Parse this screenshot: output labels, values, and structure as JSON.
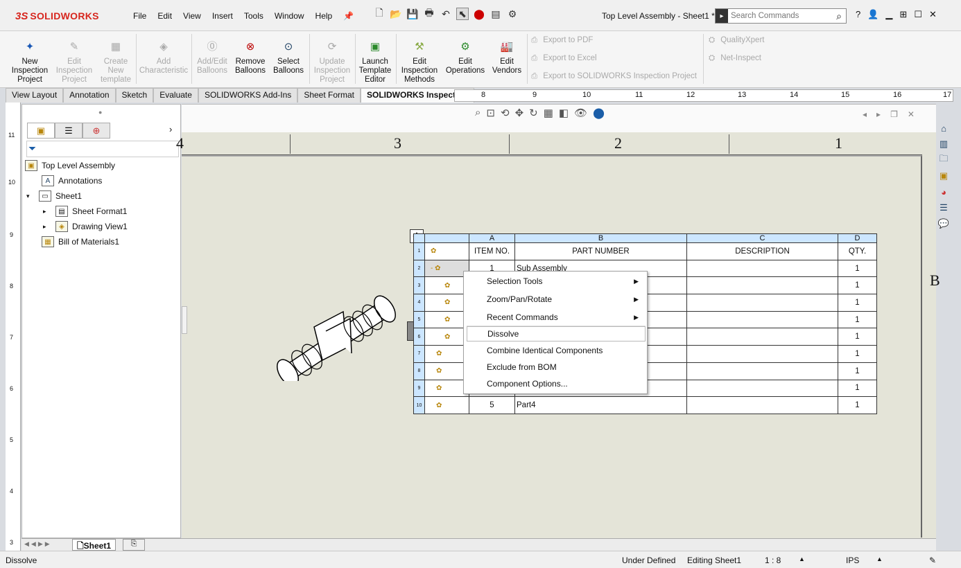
{
  "app": {
    "brand_ds": "3S",
    "brand_name": "SOLIDWORKS",
    "doc_title": "Top Level Assembly - Sheet1 *"
  },
  "menu": [
    "File",
    "Edit",
    "View",
    "Insert",
    "Tools",
    "Window",
    "Help"
  ],
  "search": {
    "placeholder": "Search Commands"
  },
  "ribbon": {
    "buttons": [
      {
        "label": "New Inspection Project",
        "enabled": true
      },
      {
        "label": "Edit Inspection Project",
        "enabled": false
      },
      {
        "label": "Create New template",
        "enabled": false
      },
      {
        "label": "Add Characteristic",
        "enabled": false
      },
      {
        "label": "Add/Edit Balloons",
        "enabled": false
      },
      {
        "label": "Remove Balloons",
        "enabled": true
      },
      {
        "label": "Select Balloons",
        "enabled": true
      },
      {
        "label": "Update Inspection Project",
        "enabled": false
      },
      {
        "label": "Launch Template Editor",
        "enabled": true
      },
      {
        "label": "Edit Inspection Methods",
        "enabled": true
      },
      {
        "label": "Edit Operations",
        "enabled": true
      },
      {
        "label": "Edit Vendors",
        "enabled": true
      }
    ],
    "exports": [
      "Export to PDF",
      "Export to Excel",
      "Export to SOLIDWORKS Inspection Project"
    ],
    "addins": [
      "QualityXpert",
      "Net-Inspect"
    ]
  },
  "tabs": [
    "View Layout",
    "Annotation",
    "Sketch",
    "Evaluate",
    "SOLIDWORKS Add-Ins",
    "Sheet Format",
    "SOLIDWORKS Inspection"
  ],
  "ruler_top": [
    "8",
    "9",
    "10",
    "11",
    "12",
    "13",
    "14",
    "15",
    "16",
    "17"
  ],
  "ruler_left": [
    "11",
    "10",
    "9",
    "8",
    "7",
    "6",
    "5",
    "4",
    "3"
  ],
  "tree": {
    "root": "Top Level Assembly",
    "items": [
      "Annotations",
      "Sheet1",
      "Sheet Format1",
      "Drawing View1",
      "Bill of Materials1"
    ]
  },
  "zones": [
    "4",
    "3",
    "2",
    "1"
  ],
  "zone_side": "B",
  "bom": {
    "col_letters": [
      "A",
      "B",
      "C",
      "D"
    ],
    "headers": [
      "ITEM NO.",
      "PART NUMBER",
      "DESCRIPTION",
      "QTY."
    ],
    "rows": [
      {
        "rn": "2",
        "item": "1",
        "part": "Sub Assembly",
        "qty": "1"
      },
      {
        "rn": "3",
        "item": "",
        "part": "",
        "qty": "1"
      },
      {
        "rn": "4",
        "item": "",
        "part": "",
        "qty": "1"
      },
      {
        "rn": "5",
        "item": "",
        "part": "",
        "qty": "1"
      },
      {
        "rn": "6",
        "item": "",
        "part": "",
        "qty": "1"
      },
      {
        "rn": "7",
        "item": "",
        "part": "",
        "qty": "1"
      },
      {
        "rn": "8",
        "item": "",
        "part": "",
        "qty": "1"
      },
      {
        "rn": "9",
        "item": "",
        "part": "",
        "qty": "1"
      },
      {
        "rn": "10",
        "item": "5",
        "part": "Part4",
        "qty": "1"
      }
    ],
    "header_rn": "1"
  },
  "context_menu": [
    "Selection Tools",
    "Zoom/Pan/Rotate",
    "Recent Commands",
    "Dissolve",
    "Combine Identical Components",
    "Exclude from BOM",
    "Component Options..."
  ],
  "sheet_tab": "Sheet1",
  "status": {
    "message": "Dissolve",
    "state": "Under Defined",
    "editing": "Editing Sheet1",
    "scale": "1 : 8",
    "units": "IPS"
  }
}
